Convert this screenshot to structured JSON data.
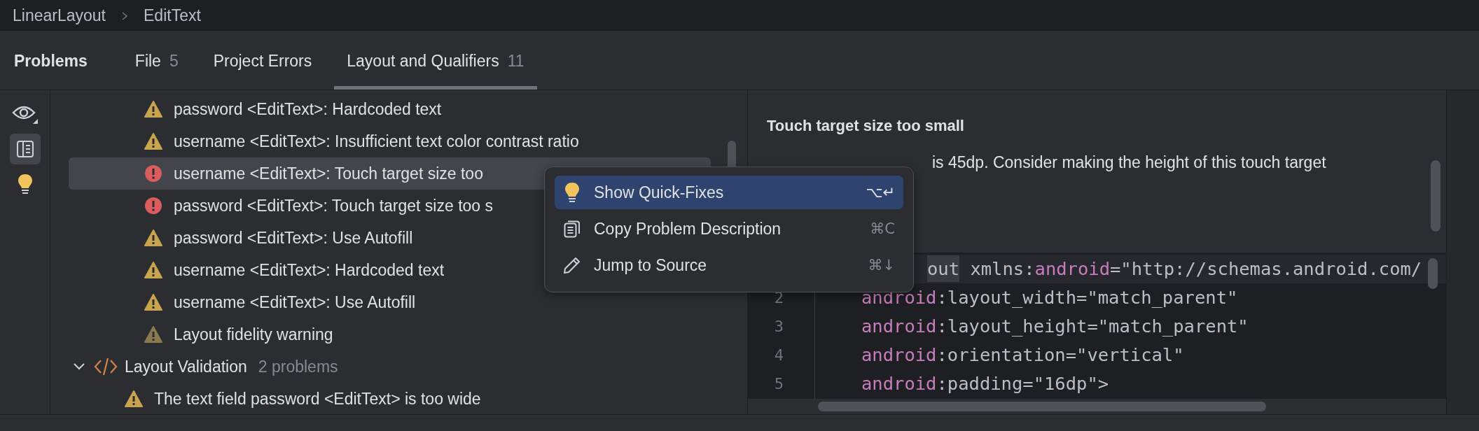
{
  "breadcrumbs": [
    "LinearLayout",
    "EditText"
  ],
  "tool_window": {
    "title": "Problems"
  },
  "tabs": [
    {
      "label": "File",
      "count": "5",
      "selected": false
    },
    {
      "label": "Project Errors",
      "selected": false
    },
    {
      "label": "Layout and Qualifiers",
      "count": "11",
      "selected": true
    }
  ],
  "side_toolbar": [
    {
      "kind": "eye",
      "selected": false
    },
    {
      "kind": "preview",
      "selected": true
    },
    {
      "kind": "bulb",
      "selected": false
    }
  ],
  "problems": [
    {
      "kind": "warning",
      "text": "password <EditText>: Hardcoded text",
      "selected": false
    },
    {
      "kind": "warning",
      "text": "username <EditText>: Insufficient text color contrast ratio",
      "selected": false
    },
    {
      "kind": "error",
      "text": "username <EditText>: Touch target size too",
      "selected": true
    },
    {
      "kind": "error",
      "text": "password <EditText>: Touch target size too s",
      "selected": false
    },
    {
      "kind": "warning",
      "text": "password <EditText>: Use Autofill",
      "selected": false
    },
    {
      "kind": "warning",
      "text": "username <EditText>: Hardcoded text",
      "selected": false
    },
    {
      "kind": "warning",
      "text": "username <EditText>: Use Autofill",
      "selected": false
    },
    {
      "kind": "weak",
      "text": "Layout fidelity warning",
      "selected": false
    },
    {
      "kind": "group",
      "label": "Layout Validation",
      "count": "2 problems",
      "expanded": true,
      "selected": false,
      "children": [
        {
          "kind": "warning",
          "text": "The text field password <EditText> is too wide",
          "selected": false
        }
      ]
    }
  ],
  "detail": {
    "title": "Touch target size too small",
    "description": "is 45dp. Consider making the height of this touch target"
  },
  "code": {
    "lines": [
      {
        "segments": [
          {
            "kind": "tag",
            "text": "out"
          },
          {
            "kind": "plain",
            "text": " xmlns:"
          },
          {
            "kind": "attr",
            "text": "android"
          },
          {
            "kind": "plain",
            "text": "=\"http://schemas.android.com/"
          }
        ]
      },
      {
        "number": "2",
        "segments": [
          {
            "kind": "attr",
            "text": "android"
          },
          {
            "kind": "plain",
            "text": ":layout_width=\"match_parent\""
          }
        ]
      },
      {
        "number": "3",
        "segments": [
          {
            "kind": "attr",
            "text": "android"
          },
          {
            "kind": "plain",
            "text": ":layout_height=\"match_parent\""
          }
        ]
      },
      {
        "number": "4",
        "segments": [
          {
            "kind": "attr",
            "text": "android"
          },
          {
            "kind": "plain",
            "text": ":orientation=\"vertical\""
          }
        ]
      },
      {
        "number": "5",
        "segments": [
          {
            "kind": "attr",
            "text": "android"
          },
          {
            "kind": "plain",
            "text": ":padding=\"16dp\">"
          }
        ]
      }
    ]
  },
  "context_menu": {
    "items": [
      {
        "kind": "bulb",
        "label": "Show Quick-Fixes",
        "shortcut": "⌥↵",
        "selected": true
      },
      {
        "kind": "copy",
        "label": "Copy Problem Description",
        "shortcut": "⌘C",
        "selected": false
      },
      {
        "kind": "pencil",
        "label": "Jump to Source",
        "shortcut": "⌘↓",
        "selected": false
      }
    ]
  }
}
